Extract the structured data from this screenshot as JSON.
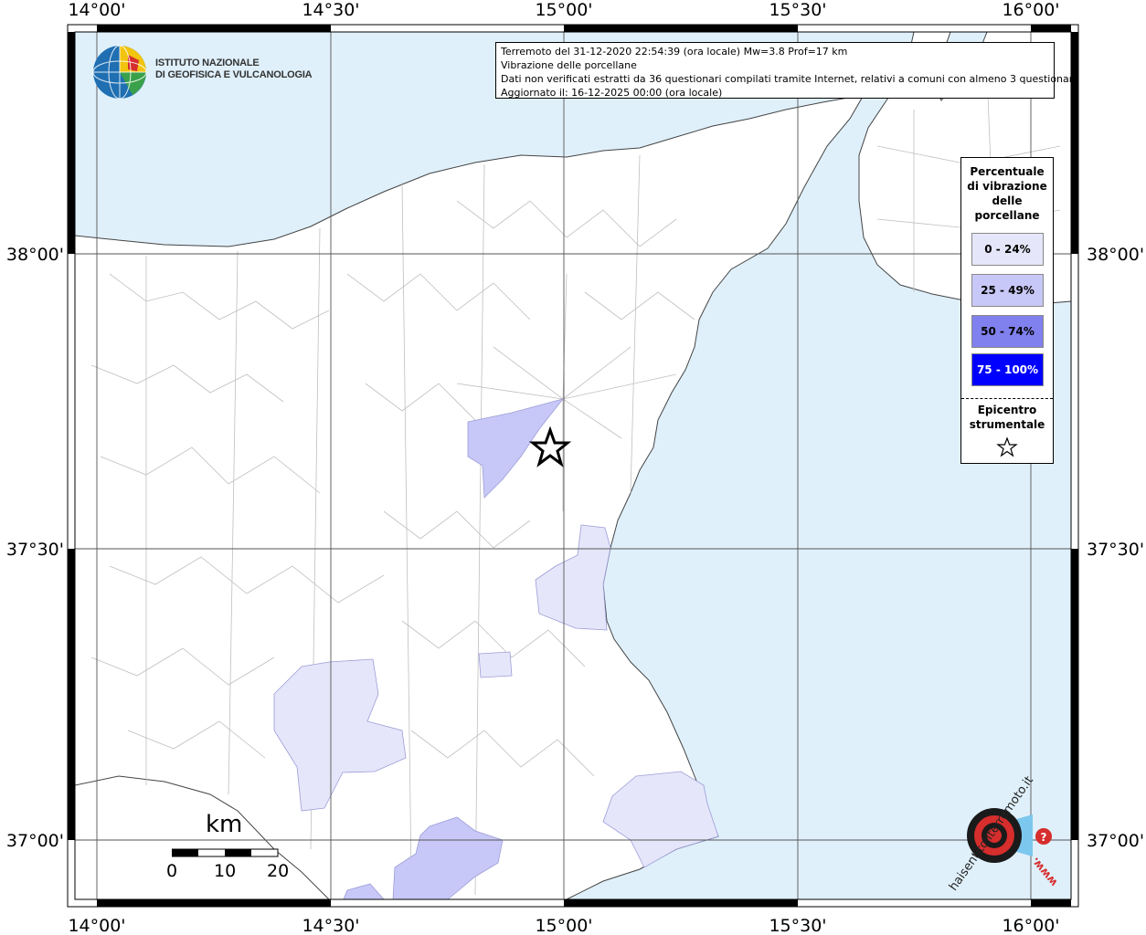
{
  "info": {
    "line1": "Terremoto del 31-12-2020 22:54:39 (ora locale) Mw=3.8 Prof=17 km",
    "line2": "Vibrazione delle porcellane",
    "line3": "Dati non verificati estratti da 36 questionari compilati tramite Internet, relativi a comuni con almeno 3 questionari.",
    "line4": "Aggiornato il: 16-12-2025 00:00 (ora locale)"
  },
  "axes": {
    "lon_labels": [
      "14°00'",
      "14°30'",
      "15°00'",
      "15°30'",
      "16°00'"
    ],
    "lat_labels": [
      "38°00'",
      "37°30'",
      "37°00'"
    ]
  },
  "legend": {
    "title": "Percentuale di vibrazione delle porcellane",
    "classes": [
      {
        "label": "0 - 24%",
        "color": "#e6e6fa"
      },
      {
        "label": "25 - 49%",
        "color": "#c8c8f8"
      },
      {
        "label": "50 - 74%",
        "color": "#8080ee"
      },
      {
        "label": "75 - 100%",
        "color": "#0000ff"
      }
    ],
    "epicenter_label": "Epicentro strumentale",
    "epicenter_icon": "star-icon"
  },
  "logos": {
    "ingv_line1": "ISTITUTO NAZIONALE",
    "ingv_line2": "DI GEOFISICA E VULCANOLOGIA",
    "hse_text": "haisentitoilterremoto.it",
    "hse_www": "www."
  },
  "scale": {
    "unit": "km",
    "ticks": [
      "0",
      "10",
      "20"
    ]
  },
  "colors": {
    "sea": "#dff0fb",
    "land": "#ffffff",
    "borders": "#bfbfbf",
    "grid": "#555555"
  }
}
